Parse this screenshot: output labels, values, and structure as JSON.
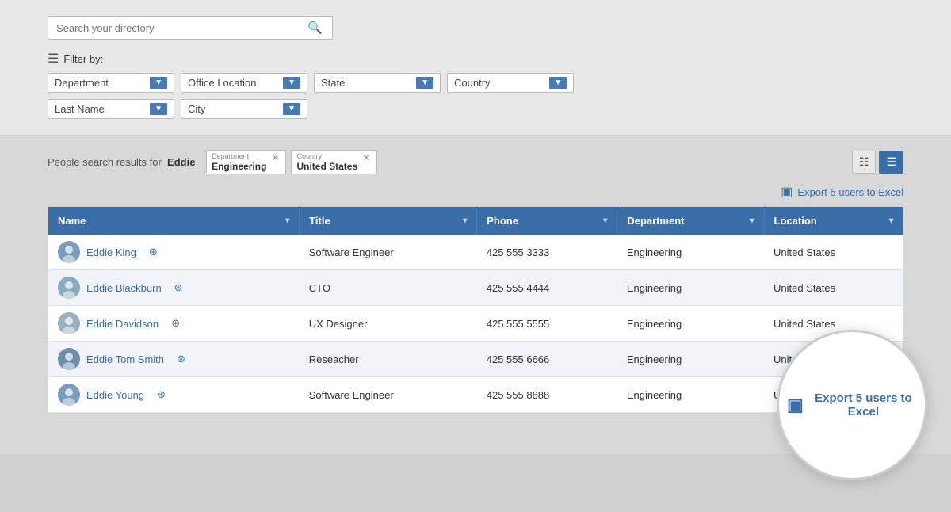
{
  "search": {
    "placeholder": "Search your directory"
  },
  "filter": {
    "label": "Filter by:",
    "row1": [
      {
        "id": "department",
        "label": "Department"
      },
      {
        "id": "office-location",
        "label": "Office Location"
      },
      {
        "id": "state",
        "label": "State"
      },
      {
        "id": "country",
        "label": "Country"
      }
    ],
    "row2": [
      {
        "id": "last-name",
        "label": "Last Name"
      },
      {
        "id": "city",
        "label": "City"
      }
    ]
  },
  "results": {
    "prefix": "People search results for ",
    "query": "Eddie",
    "active_filters": [
      {
        "label": "Department",
        "value": "Engineering"
      },
      {
        "label": "Country",
        "value": "United States"
      }
    ]
  },
  "export": {
    "label": "Export 5 users to Excel",
    "magnified": "Export 5 users to Excel"
  },
  "table": {
    "columns": [
      {
        "id": "name",
        "label": "Name"
      },
      {
        "id": "title",
        "label": "Title"
      },
      {
        "id": "phone",
        "label": "Phone"
      },
      {
        "id": "department",
        "label": "Department"
      },
      {
        "id": "location",
        "label": "Location"
      }
    ],
    "rows": [
      {
        "name": "Eddie King",
        "title": "Software Engineer",
        "phone": "425 555 3333",
        "department": "Engineering",
        "location": "United States",
        "avatar_color": "#7a9dbf"
      },
      {
        "name": "Eddie Blackburn",
        "title": "CTO",
        "phone": "425 555 4444",
        "department": "Engineering",
        "location": "United States",
        "avatar_color": "#8aacbf"
      },
      {
        "name": "Eddie Davidson",
        "title": "UX Designer",
        "phone": "425 555 5555",
        "department": "Engineering",
        "location": "United States",
        "avatar_color": "#9ab0c0"
      },
      {
        "name": "Eddie Tom Smith",
        "title": "Reseacher",
        "phone": "425 555 6666",
        "department": "Engineering",
        "location": "United States",
        "avatar_color": "#6a8faa"
      },
      {
        "name": "Eddie Young",
        "title": "Software Engineer",
        "phone": "425 555 8888",
        "department": "Engineering",
        "location": "United States",
        "avatar_color": "#7a9dbf"
      }
    ]
  }
}
